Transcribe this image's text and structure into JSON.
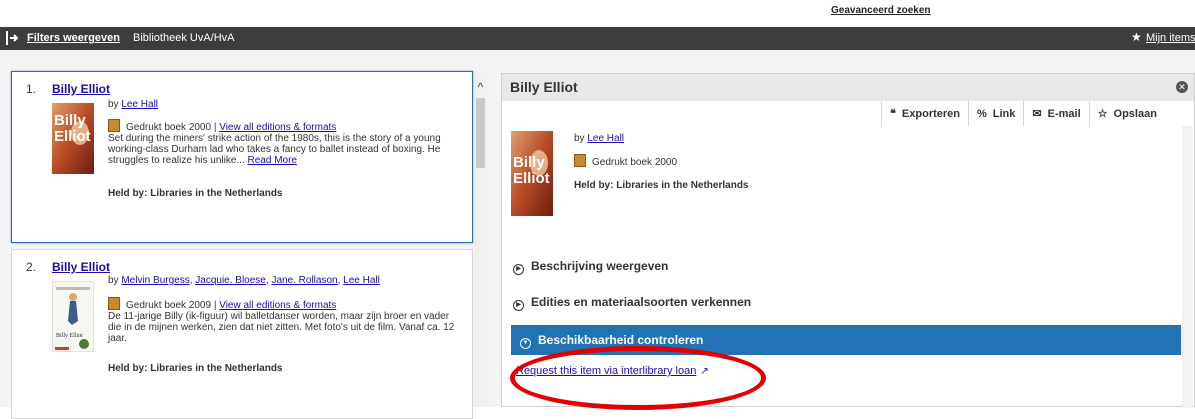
{
  "top": {
    "advanced_search": "Geavanceerd zoeken"
  },
  "topbar": {
    "filters_label": "Filters weergeven",
    "library": "Bibliotheek UvA/HvA",
    "my_items": "Mijn items",
    "bg_color": "#3d3d3d"
  },
  "results": [
    {
      "num": "1.",
      "title": "Billy Elliot",
      "by": "by ",
      "authors": [
        "Lee Hall"
      ],
      "format": "Gedrukt boek 2000 | ",
      "editions_link": "View all editions & formats",
      "description": "Set during the miners' strike action of the 1980s, this is the story of a young working-class Durham lad who takes a fancy to ballet instead of boxing. He struggles to realize his unlike... ",
      "read_more": "Read More",
      "held_by": "Held by: Libraries in the Netherlands",
      "cover_text": [
        "Billy",
        "Elliot"
      ]
    },
    {
      "num": "2.",
      "title": "Billy Elliot",
      "by": "by ",
      "authors": [
        "Melvin Burgess",
        "Jacquie. Bloese",
        "Jane. Rollason",
        "Lee Hall"
      ],
      "format": "Gedrukt boek 2009 | ",
      "editions_link": "View all editions & formats",
      "description": "De 11-jarige Billy (ik-figuur) wil balletdanser worden, maar zijn broer en vader die in de mijnen werken, zien dat niet zitten. Met foto's uit de film. Vanaf ca. 12 jaar.",
      "held_by": "Held by: Libraries in the Netherlands",
      "cover_text": [
        "Billy Elliot"
      ]
    }
  ],
  "detail": {
    "title": "Billy Elliot",
    "toolbar": [
      {
        "icon": "quote-icon",
        "glyph": "❝",
        "label": "Exporteren"
      },
      {
        "icon": "link-icon",
        "glyph": "%",
        "label": "Link"
      },
      {
        "icon": "email-icon",
        "glyph": "✉",
        "label": "E-mail"
      },
      {
        "icon": "star-icon",
        "glyph": "☆",
        "label": "Opslaan"
      }
    ],
    "by": "by ",
    "author": "Lee Hall",
    "format": "Gedrukt boek 2000",
    "held_by": "Held by: Libraries in the Netherlands",
    "cover_text": [
      "Billy",
      "Elliot"
    ],
    "sections": [
      "Beschrijving weergeven",
      "Edities en materiaalsoorten verkennen",
      "Beschikbaarheid controleren"
    ],
    "ill_link": "Request this item via interlibrary loan",
    "accent": "#2272b5",
    "highlight": "#e30000"
  }
}
